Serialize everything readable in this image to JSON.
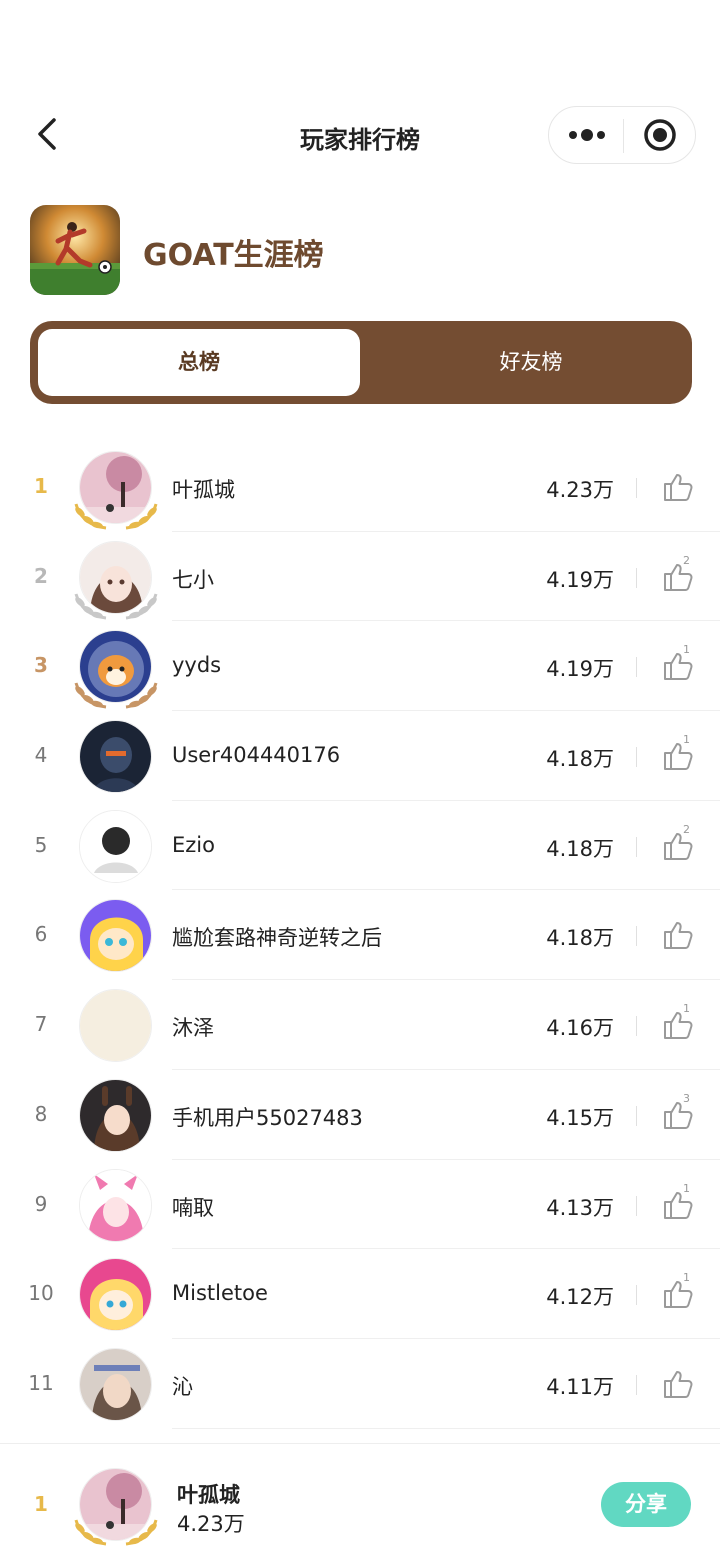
{
  "nav": {
    "title": "玩家排行榜"
  },
  "game": {
    "title": "GOAT生涯榜"
  },
  "tabs": [
    {
      "label": "总榜"
    },
    {
      "label": "好友榜"
    }
  ],
  "rows": [
    {
      "rank": "1",
      "name": "叶孤城",
      "score": "4.23万",
      "likes": ""
    },
    {
      "rank": "2",
      "name": "七小",
      "score": "4.19万",
      "likes": "2"
    },
    {
      "rank": "3",
      "name": "yyds",
      "score": "4.19万",
      "likes": "1"
    },
    {
      "rank": "4",
      "name": "User404440176",
      "score": "4.18万",
      "likes": "1"
    },
    {
      "rank": "5",
      "name": "Ezio",
      "score": "4.18万",
      "likes": "2"
    },
    {
      "rank": "6",
      "name": "尴尬套路神奇逆转之后",
      "score": "4.18万",
      "likes": ""
    },
    {
      "rank": "7",
      "name": "沐泽",
      "score": "4.16万",
      "likes": "1"
    },
    {
      "rank": "8",
      "name": "手机用户55027483",
      "score": "4.15万",
      "likes": "3"
    },
    {
      "rank": "9",
      "name": "喃取",
      "score": "4.13万",
      "likes": "1"
    },
    {
      "rank": "10",
      "name": "Mistletoe",
      "score": "4.12万",
      "likes": "1"
    },
    {
      "rank": "11",
      "name": "沁",
      "score": "4.11万",
      "likes": ""
    }
  ],
  "me": {
    "rank": "1",
    "name": "叶孤城",
    "score": "4.23万"
  },
  "share_label": "分享",
  "colors": {
    "brand_brown": "#744d32",
    "gold": "#e7b94a",
    "silver": "#b8b8b8",
    "bronze": "#c79565",
    "share": "#61d8c2"
  }
}
